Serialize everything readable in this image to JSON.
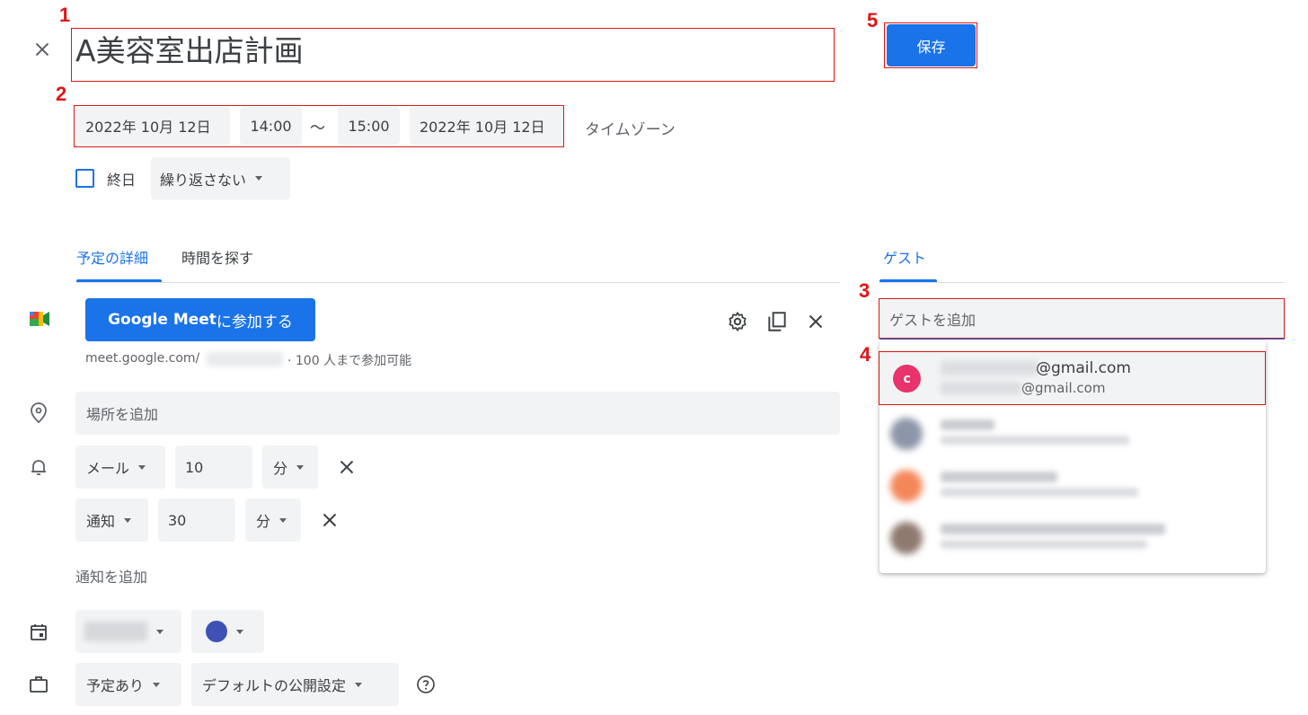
{
  "header": {
    "title": "A美容室出店計画",
    "save_label": "保存"
  },
  "datetime": {
    "start_date": "2022年 10月 12日",
    "start_time": "14:00",
    "separator": "〜",
    "end_time": "15:00",
    "end_date": "2022年 10月 12日",
    "timezone_label": "タイムゾーン"
  },
  "options": {
    "all_day_label": "終日",
    "all_day_checked": false,
    "repeat_label": "繰り返さない"
  },
  "tabs": {
    "details": "予定の詳細",
    "find_time": "時間を探す",
    "guests": "ゲスト"
  },
  "meet": {
    "button_prefix": "Google Meet",
    "button_suffix": " に参加する",
    "link_prefix": "meet.google.com/",
    "capacity": "· 100 人まで参加可能"
  },
  "location": {
    "placeholder": "場所を追加"
  },
  "notifications": [
    {
      "type": "メール",
      "value": "10",
      "unit": "分"
    },
    {
      "type": "通知",
      "value": "30",
      "unit": "分"
    }
  ],
  "add_notification_label": "通知を追加",
  "calendar": {
    "color": "#3f51b5"
  },
  "visibility": {
    "status_label": "予定あり",
    "visibility_label": "デフォルトの公開設定"
  },
  "guests": {
    "add_placeholder": "ゲストを追加",
    "suggestions": [
      {
        "avatar_letter": "c",
        "avatar_color": "#e8336b",
        "name_suffix": "@gmail.com",
        "email_suffix": "@gmail.com"
      }
    ]
  },
  "annotations": [
    "1",
    "2",
    "3",
    "4",
    "5"
  ],
  "colors": {
    "accent": "#1a73e8",
    "annotation": "#e01414"
  }
}
